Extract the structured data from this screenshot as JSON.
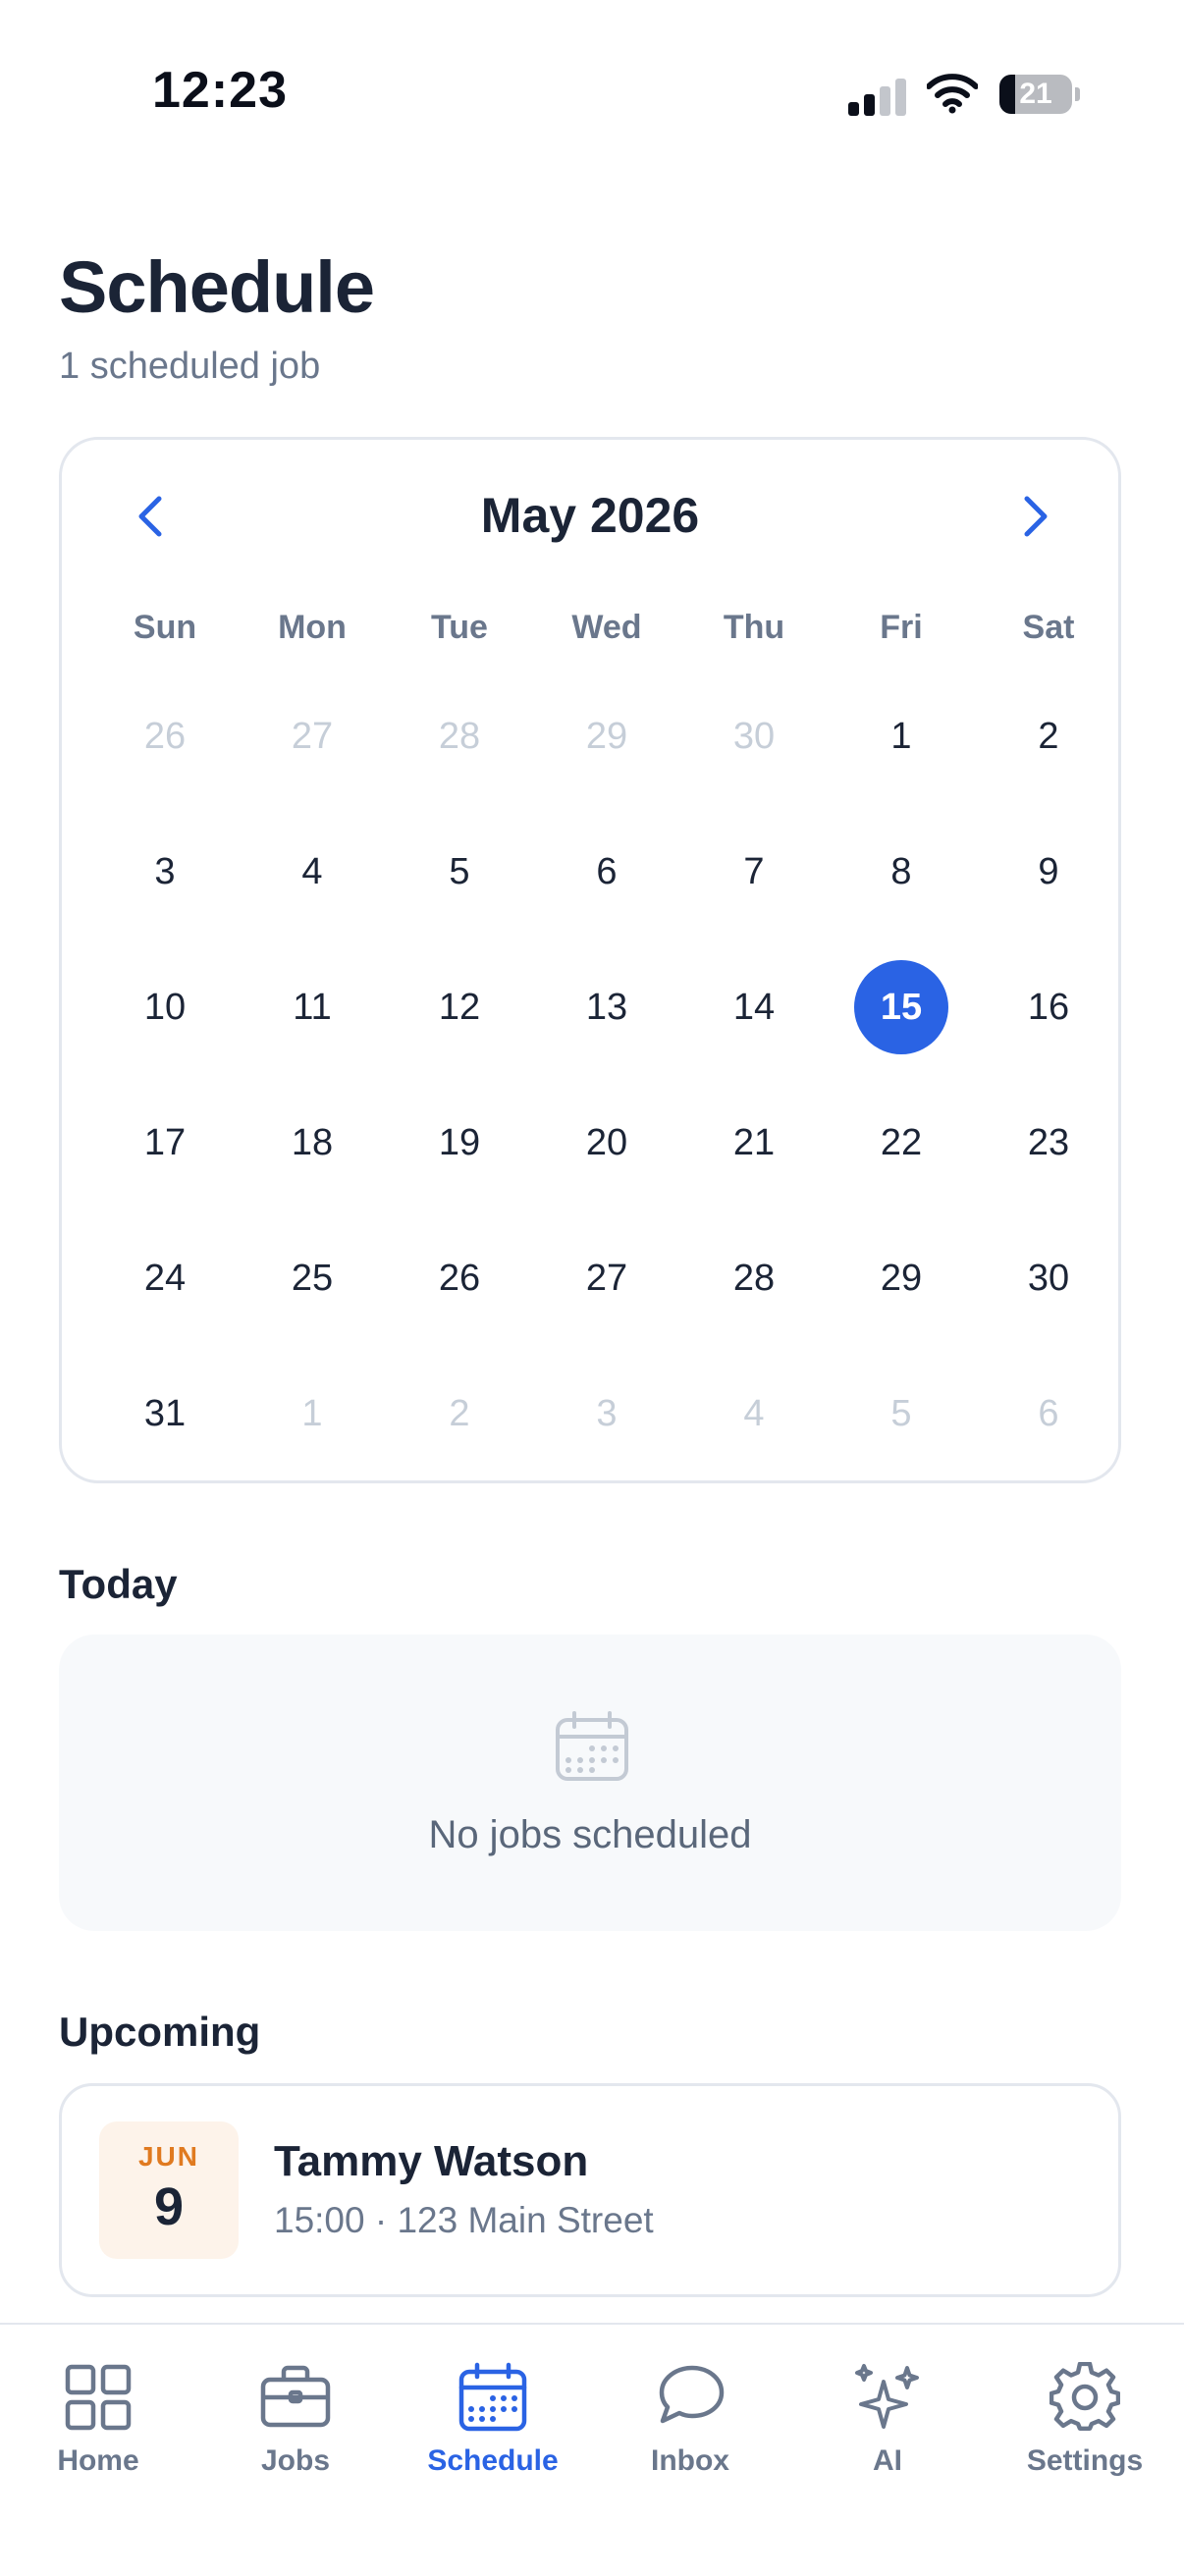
{
  "status_bar": {
    "time": "12:23",
    "battery": "21"
  },
  "header": {
    "title": "Schedule",
    "subtitle": "1 scheduled job"
  },
  "calendar": {
    "month_label": "May 2026",
    "weekdays": [
      "Sun",
      "Mon",
      "Tue",
      "Wed",
      "Thu",
      "Fri",
      "Sat"
    ],
    "weeks": [
      [
        {
          "d": "26",
          "muted": true
        },
        {
          "d": "27",
          "muted": true
        },
        {
          "d": "28",
          "muted": true
        },
        {
          "d": "29",
          "muted": true
        },
        {
          "d": "30",
          "muted": true
        },
        {
          "d": "1"
        },
        {
          "d": "2"
        }
      ],
      [
        {
          "d": "3"
        },
        {
          "d": "4"
        },
        {
          "d": "5"
        },
        {
          "d": "6"
        },
        {
          "d": "7"
        },
        {
          "d": "8"
        },
        {
          "d": "9"
        }
      ],
      [
        {
          "d": "10"
        },
        {
          "d": "11"
        },
        {
          "d": "12"
        },
        {
          "d": "13"
        },
        {
          "d": "14"
        },
        {
          "d": "15",
          "selected": true
        },
        {
          "d": "16"
        }
      ],
      [
        {
          "d": "17"
        },
        {
          "d": "18"
        },
        {
          "d": "19"
        },
        {
          "d": "20"
        },
        {
          "d": "21"
        },
        {
          "d": "22"
        },
        {
          "d": "23"
        }
      ],
      [
        {
          "d": "24"
        },
        {
          "d": "25"
        },
        {
          "d": "26"
        },
        {
          "d": "27"
        },
        {
          "d": "28"
        },
        {
          "d": "29"
        },
        {
          "d": "30"
        }
      ],
      [
        {
          "d": "31"
        },
        {
          "d": "1",
          "muted": true
        },
        {
          "d": "2",
          "muted": true
        },
        {
          "d": "3",
          "muted": true
        },
        {
          "d": "4",
          "muted": true
        },
        {
          "d": "5",
          "muted": true
        },
        {
          "d": "6",
          "muted": true
        }
      ]
    ]
  },
  "today": {
    "title": "Today",
    "empty_text": "No jobs scheduled"
  },
  "upcoming": {
    "title": "Upcoming",
    "jobs": [
      {
        "month": "JUN",
        "day": "9",
        "name": "Tammy Watson",
        "meta": "15:00 · 123 Main Street"
      }
    ]
  },
  "tabs": [
    {
      "label": "Home",
      "icon": "grid-icon",
      "active": false
    },
    {
      "label": "Jobs",
      "icon": "briefcase-icon",
      "active": false
    },
    {
      "label": "Schedule",
      "icon": "calendar-icon",
      "active": true
    },
    {
      "label": "Inbox",
      "icon": "chat-bubble-icon",
      "active": false
    },
    {
      "label": "AI",
      "icon": "sparkles-icon",
      "active": false
    },
    {
      "label": "Settings",
      "icon": "gear-icon",
      "active": false
    }
  ],
  "colors": {
    "accent": "#2a63e4",
    "text": "#1b2436",
    "muted_text": "#6a778c",
    "date_chip_bg": "#fdf3ea",
    "date_chip_month": "#e07a20"
  }
}
